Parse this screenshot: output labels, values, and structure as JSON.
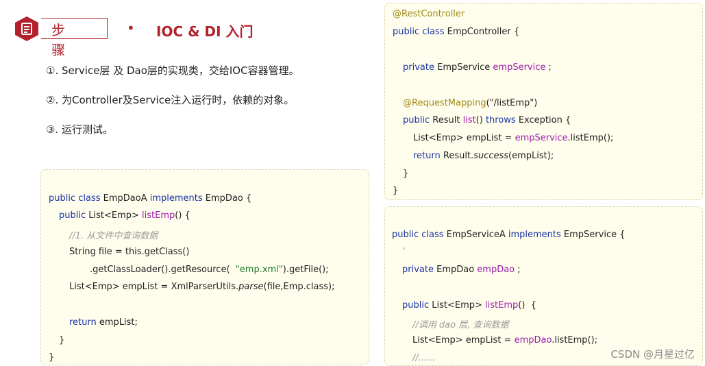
{
  "header": {
    "step_label": "步骤",
    "bullet": "•",
    "title": "IOC & DI 入门",
    "icon": "document-icon",
    "accent_color": "#b3222c"
  },
  "steps": [
    "①. Service层 及 Dao层的实现类，交给IOC容器管理。",
    "②. 为Controller及Service注入运行时，依赖的对象。",
    "③. 运行测试。"
  ],
  "code_dao": {
    "l1": [
      "public class",
      " EmpDaoA ",
      "implements",
      " EmpDao {"
    ],
    "l2": [
      "public",
      " List<Emp> ",
      "listEmp",
      "() {"
    ],
    "l3": "//1. 从文件中查询数据",
    "l4": "String file = this.getClass()",
    "l5": [
      ".getClassLoader().getResource(  ",
      "\"emp.xml\"",
      ").getFile();"
    ],
    "l6": [
      "List<Emp> empList = XmlParserUtils.",
      "parse",
      "(file,Emp.class);"
    ],
    "l7": [
      "return",
      " empList;"
    ],
    "l8": "}",
    "l9": "}"
  },
  "code_controller": {
    "l1": "@RestController",
    "l2": [
      "public class",
      " EmpController {"
    ],
    "l3": [
      "private",
      " EmpService ",
      "empService",
      " ;"
    ],
    "l4": [
      "@RequestMapping",
      "(\"/listEmp\")"
    ],
    "l5": [
      "public",
      " Result ",
      "list",
      "() ",
      "throws",
      " Exception {"
    ],
    "l6": [
      "List<Emp> empList = ",
      "empService",
      ".listEmp();"
    ],
    "l7": [
      "return",
      " Result.",
      "success",
      "(empList);"
    ],
    "l8": "}",
    "l9": "}"
  },
  "code_service": {
    "l1": [
      "public class",
      " EmpServiceA ",
      "implements",
      " EmpService {"
    ],
    "caret": "'",
    "l2": [
      "private",
      " EmpDao ",
      "empDao",
      " ;"
    ],
    "l3": [
      "public",
      " List<Emp> ",
      "listEmp",
      "()  {"
    ],
    "l4": "//调用 dao 层, 查询数据",
    "l5": [
      "List<Emp> empList = ",
      "empDao",
      ".listEmp();"
    ],
    "l6": "//......"
  },
  "watermark": "CSDN @月星过亿"
}
